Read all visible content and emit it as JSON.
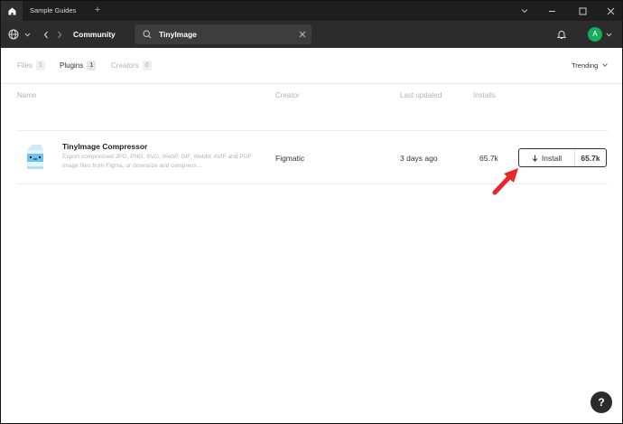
{
  "titlebar": {
    "tab_label": "Sample Guides",
    "add_tab": "+"
  },
  "toolbar": {
    "breadcrumb": "Community",
    "search_value": "TinyImage",
    "avatar_letter": "A"
  },
  "filters": [
    {
      "label": "Files",
      "count": "1"
    },
    {
      "label": "Plugins",
      "count": "1"
    },
    {
      "label": "Creators",
      "count": "0"
    }
  ],
  "sort": {
    "label": "Trending"
  },
  "columns": {
    "name": "Name",
    "creator": "Creator",
    "last_updated": "Last updated",
    "installs": "Installs"
  },
  "result": {
    "name": "TinyImage Compressor",
    "description": "Export compressed JPG, PNG, SVG, WebP, GIF, WebM, AVIF and PDF image files from Figma, or downsize and compress…",
    "creator": "Figmatic",
    "last_updated": "3 days ago",
    "installs": "65.7k",
    "install_label": "Install",
    "install_count": "65.7k"
  },
  "help": {
    "label": "?"
  },
  "colors": {
    "accent_arrow": "#e8262b",
    "avatar": "#14ae5c",
    "toolbar": "#2c2c2c"
  }
}
